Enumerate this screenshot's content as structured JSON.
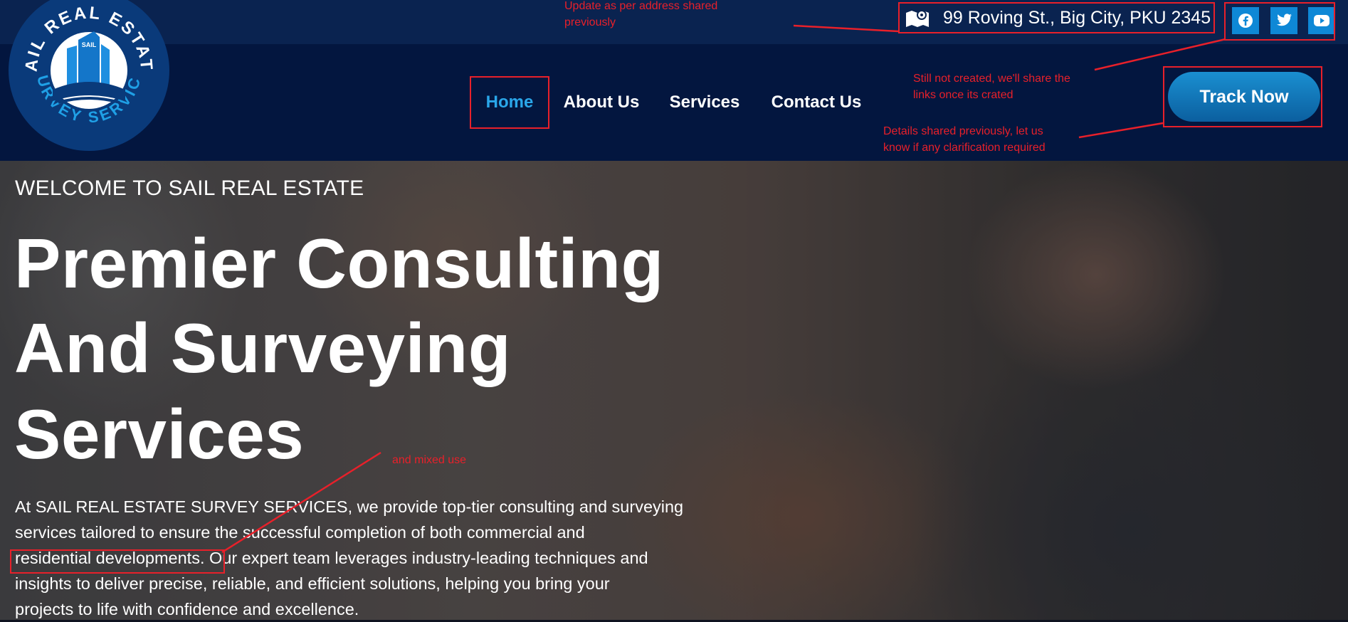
{
  "header": {
    "address": "99 Roving St., Big City, PKU 2345",
    "social": [
      {
        "icon": "facebook-icon"
      },
      {
        "icon": "twitter-icon"
      },
      {
        "icon": "youtube-icon"
      }
    ],
    "logo": {
      "top_text": "SAIL REAL ESTATE",
      "bottom_text": "SURVEY SERVICE",
      "building_text": "SAIL"
    }
  },
  "nav": {
    "items": [
      "Home",
      "About Us",
      "Services",
      "Contact Us"
    ],
    "active": "Home",
    "cta": "Track Now"
  },
  "hero": {
    "welcome": "WELCOME TO SAIL REAL ESTATE",
    "headline_lines": [
      "Premier Consulting",
      "And Surveying",
      "Services"
    ],
    "para_lines": [
      "At SAIL REAL ESTATE SURVEY SERVICES, we provide top-tier consulting and surveying",
      "services tailored to ensure the successful completion of both commercial and",
      "residential developments. Our expert team leverages industry-leading techniques and",
      "insights to deliver precise, reliable, and efficient solutions, helping you bring your",
      "projects to life with confidence and excellence."
    ]
  },
  "annotations": {
    "address_note": [
      "Update as per address shared",
      "previously"
    ],
    "social_note": [
      "Still not created, we'll share the",
      "links once its crated"
    ],
    "track_note": [
      "Details shared previously, let us",
      "know if any clarification required"
    ],
    "mixed_use_note": "and mixed use"
  },
  "colors": {
    "topbar": "#0a2350",
    "navbar": "#03163f",
    "accent": "#0e88d6",
    "annotation_red": "#e8202a"
  }
}
